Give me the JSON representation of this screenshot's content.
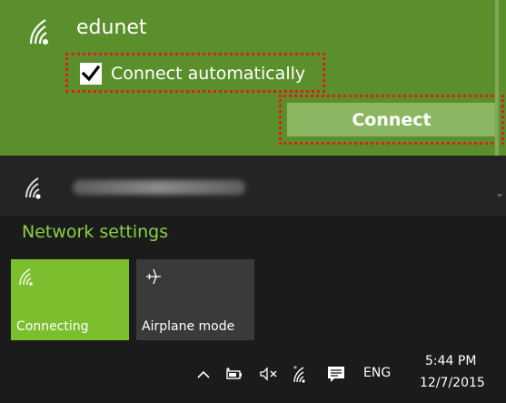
{
  "selected_network": {
    "name": "edunet",
    "auto_connect_label": "Connect automatically",
    "auto_connect_checked": true,
    "connect_label": "Connect",
    "icon": "wifi-icon"
  },
  "other_network": {
    "icon": "wifi-icon"
  },
  "settings": {
    "network_settings_label": "Network settings"
  },
  "quick_actions": [
    {
      "label": "Connecting",
      "icon": "wifi-icon",
      "active": true
    },
    {
      "label": "Airplane mode",
      "icon": "airplane-icon",
      "active": false
    }
  ],
  "taskbar": {
    "icons": [
      "chevron-up-icon",
      "battery-icon",
      "volume-muted-icon",
      "wifi-icon",
      "action-center-icon"
    ],
    "language": "ENG",
    "time": "5:44 PM",
    "date": "12/7/2015"
  },
  "colors": {
    "accent_selected": "#5b8f2c",
    "connect_button": "#8bb762",
    "link_green": "#8ad046",
    "tile_active": "#7cbf2e",
    "tile_inactive": "#3a3a3a",
    "highlight_outline": "#e21b1b"
  }
}
